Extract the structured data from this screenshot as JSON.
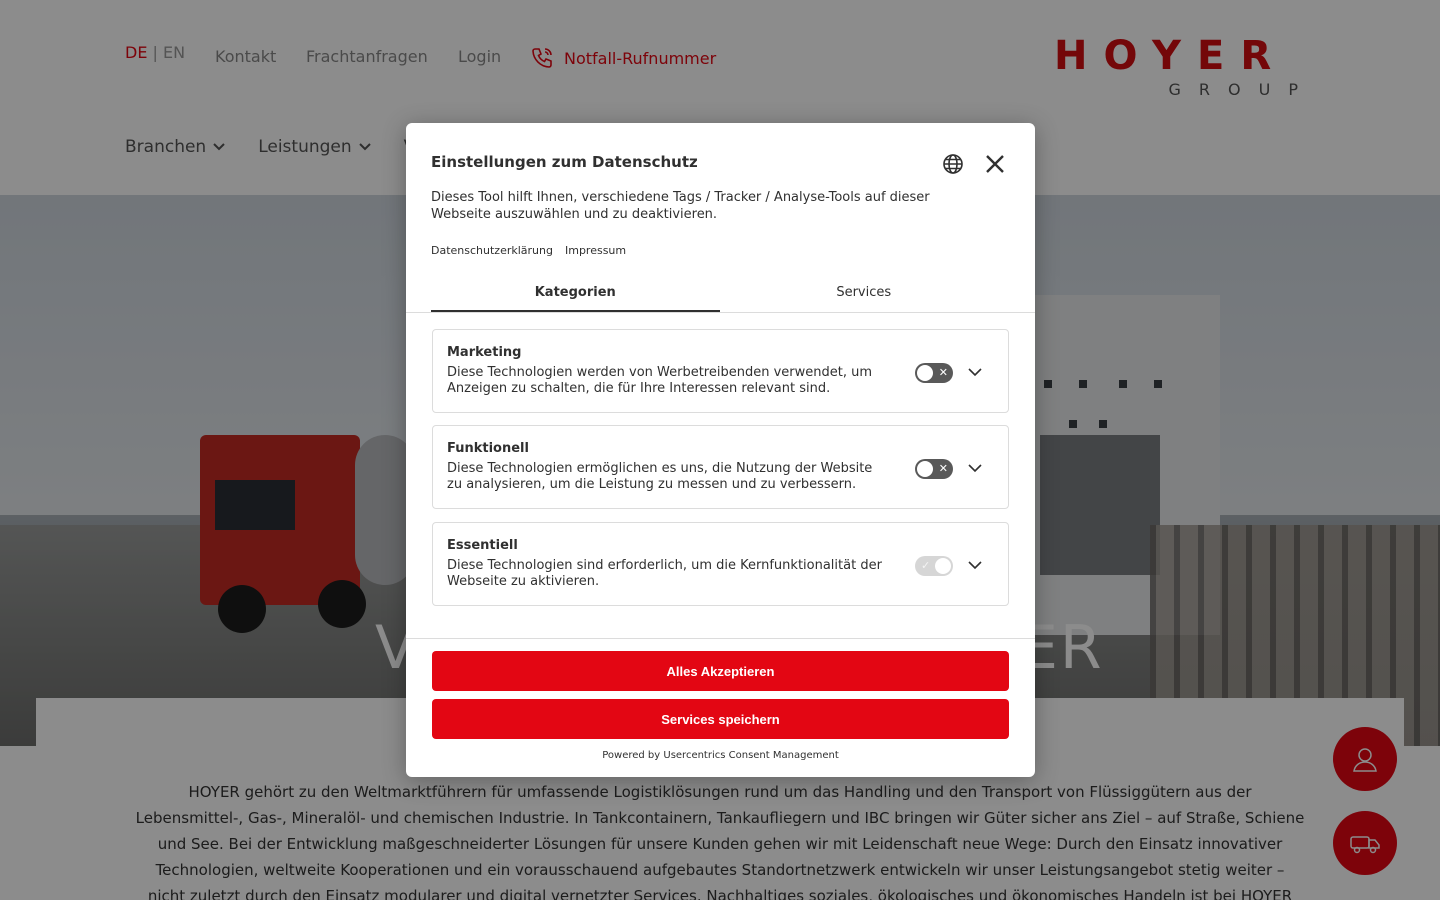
{
  "header": {
    "lang_active": "DE",
    "lang_separator": "|",
    "lang_other": "EN",
    "links": [
      "Kontakt",
      "Frachtanfragen",
      "Login"
    ],
    "emergency": "Notfall-Rufnummer",
    "logo_word": "HOYER",
    "logo_sub": "GROUP",
    "nav": [
      "Branchen",
      "Leistungen",
      "V"
    ]
  },
  "hero": {
    "text_left": "V",
    "text_right": "ER"
  },
  "intro": "HOYER gehört zu den Weltmarktführern für umfassende Logistiklösungen rund um das Handling und den Transport von Flüssiggütern aus der Lebensmittel-, Gas-, Mineralöl- und chemischen Industrie. In Tankcontainern, Tankaufliegern und IBC bringen wir Güter sicher ans Ziel – auf Straße, Schiene und See. Bei der Entwicklung maßgeschneiderter Lösungen für unsere Kunden gehen wir mit Leidenschaft neue Wege: Durch den Einsatz innovativer Technologien, weltweite Kooperationen und ein vorausschauend aufgebautes Standortnetzwerk entwickeln wir unser Leistungsangebot stetig weiter – nicht zuletzt durch den Einsatz modularer und digital vernetzter Services. Nachhaltiges soziales, ökologisches und ökonomisches Handeln ist bei HOYER gelebte Praxis. So ebnen wir den Weg in die Zukunft der Logistik und sind seit",
  "consent": {
    "title": "Einstellungen zum Datenschutz",
    "description": "Dieses Tool hilft Ihnen, verschiedene Tags / Tracker / Analyse-Tools auf dieser Webseite auszuwählen und zu deaktivieren.",
    "links": [
      "Datenschutzerklärung",
      "Impressum"
    ],
    "tabs": [
      "Kategorien",
      "Services"
    ],
    "categories": [
      {
        "name": "Marketing",
        "text": "Diese Technologien werden von Werbetreibenden verwendet, um Anzeigen zu schalten, die für Ihre Interessen relevant sind.",
        "enabled": false
      },
      {
        "name": "Funktionell",
        "text": "Diese Technologien ermöglichen es uns, die Nutzung der Website zu analysieren, um die Leistung zu messen und zu verbessern.",
        "enabled": false
      },
      {
        "name": "Essentiell",
        "text": "Diese Technologien sind erforderlich, um die Kernfunktionalität der Webseite zu aktivieren.",
        "enabled": true
      }
    ],
    "accept_all": "Alles Akzeptieren",
    "save_services": "Services speichern",
    "powered_by": "Powered by Usercentrics Consent Management"
  },
  "colors": {
    "brand_red": "#e30613",
    "text_dark": "#303030"
  }
}
